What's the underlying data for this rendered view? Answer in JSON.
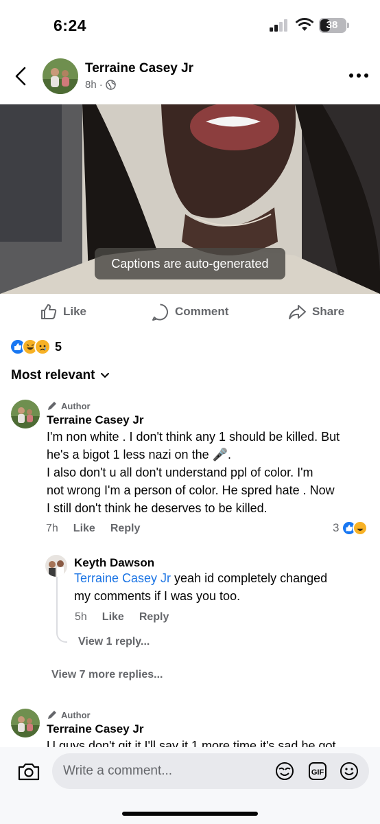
{
  "status_bar": {
    "time": "6:24",
    "battery": "38",
    "battery_level": 0.38
  },
  "post": {
    "author": "Terraine Casey Jr",
    "time": "8h",
    "privacy_separator": "·",
    "caption": "Captions are auto-generated"
  },
  "actions": {
    "like": "Like",
    "comment": "Comment",
    "share": "Share"
  },
  "reactions": {
    "count": "5",
    "types": [
      "like",
      "haha",
      "sad"
    ]
  },
  "sort": {
    "label": "Most relevant"
  },
  "comments": [
    {
      "badge": "Author",
      "name": "Terraine Casey Jr",
      "lines": [
        "I'm non white . I don't think any 1 should be killed. But",
        "he's a bigot 1 less nazi on the 🎤.",
        " I also don't u all don't understand ppl of color.  I'm",
        "not wrong I'm a person of color.  He spred hate . Now",
        "I still don't think he deserves to be killed."
      ],
      "time": "7h",
      "like": "Like",
      "reply": "Reply",
      "reaction_count": "3",
      "replies": [
        {
          "name": "Keyth Dawson",
          "mention": "Terraine Casey Jr",
          "text_first": " yeah id completely changed",
          "text_second": "my comments if I was you too.",
          "time": "5h",
          "like": "Like",
          "reply": "Reply",
          "view_more": "View 1 reply..."
        }
      ],
      "view_more_replies": "View 7 more replies..."
    },
    {
      "badge": "Author",
      "name": "Terraine Casey Jr",
      "partial_text": "U guys don't git it I'll say it 1 more time it's sad he got"
    }
  ],
  "composer": {
    "placeholder": "Write a comment..."
  }
}
